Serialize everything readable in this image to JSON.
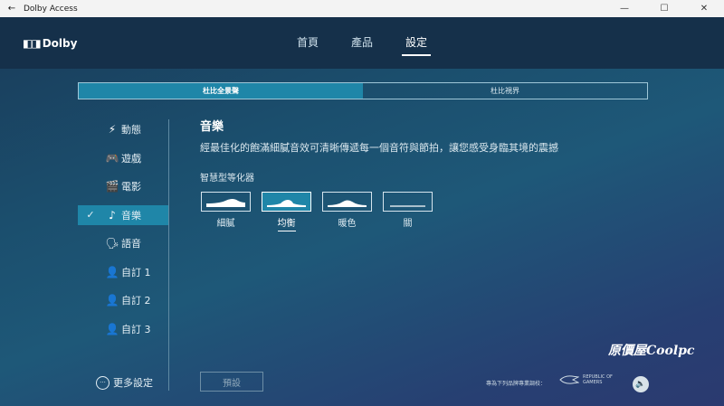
{
  "window": {
    "title": "Dolby Access",
    "back_icon": "←",
    "minimize_icon": "—",
    "maximize_icon": "☐",
    "close_icon": "✕"
  },
  "header": {
    "logo_mark": "◧◨",
    "logo_text": "Dolby",
    "nav": [
      {
        "label": "首頁"
      },
      {
        "label": "產品"
      },
      {
        "label": "設定"
      }
    ]
  },
  "tabs": [
    {
      "label": "杜比全景聲"
    },
    {
      "label": "杜比視界"
    }
  ],
  "sidebar": {
    "check_icon": "✓",
    "items": [
      {
        "label": "動態",
        "icon": "⚡"
      },
      {
        "label": "遊戲",
        "icon": "🎮"
      },
      {
        "label": "電影",
        "icon": "🎬"
      },
      {
        "label": "音樂",
        "icon": "♪"
      },
      {
        "label": "語音",
        "icon": "🗣"
      },
      {
        "label": "自訂 1",
        "icon": "👤"
      },
      {
        "label": "自訂 2",
        "icon": "👤"
      },
      {
        "label": "自訂 3",
        "icon": "👤"
      }
    ],
    "more_icon": "···",
    "more_label": "更多設定"
  },
  "main": {
    "title": "音樂",
    "description": "經最佳化的飽滿細膩音效可清晰傳遞每一個音符與節拍，讓您感受身臨其境的震撼",
    "eq_label": "智慧型等化器",
    "presets": [
      {
        "label": "細膩"
      },
      {
        "label": "均衡"
      },
      {
        "label": "暖色"
      },
      {
        "label": "關"
      }
    ],
    "reset_label": "預設"
  },
  "footer": {
    "brand_note": "專為下列品牌專業調校：",
    "rog_line1": "REPUBLIC OF",
    "rog_line2": "GAMERS",
    "volume_icon": "🔈"
  },
  "watermark": "原價屋Coolpc"
}
